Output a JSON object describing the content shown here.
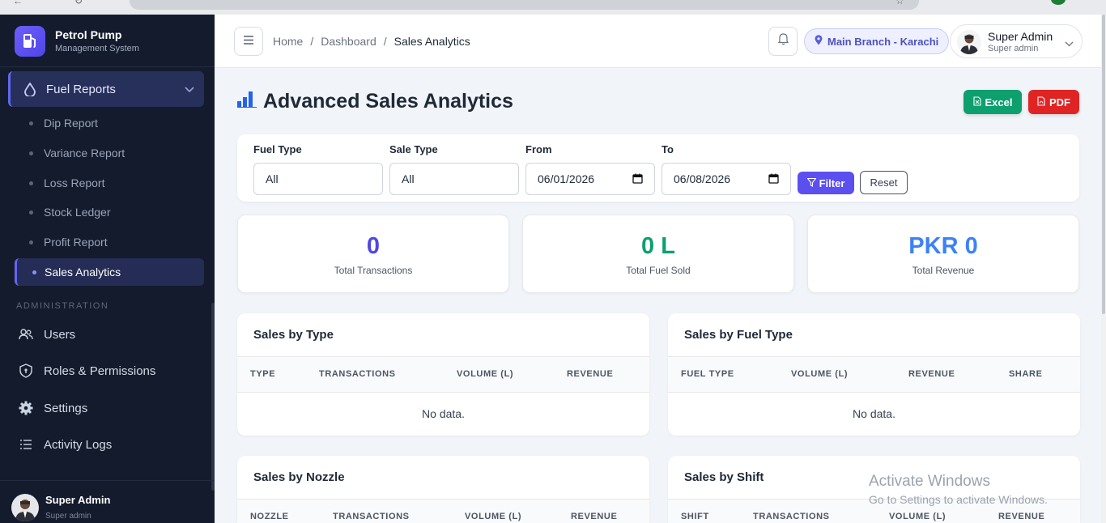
{
  "brand": {
    "title": "Petrol Pump",
    "subtitle": "Management System"
  },
  "sidebar": {
    "parent": {
      "label": "Fuel Reports",
      "icon": "droplet-icon"
    },
    "reports": [
      "Dip Report",
      "Variance Report",
      "Loss Report",
      "Stock Ledger",
      "Profit Report"
    ],
    "active": "Sales Analytics",
    "section_label": "ADMINISTRATION",
    "admin_items": [
      {
        "label": "Users",
        "icon": "users-icon"
      },
      {
        "label": "Roles & Permissions",
        "icon": "shield-icon"
      },
      {
        "label": "Settings",
        "icon": "gear-icon"
      },
      {
        "label": "Activity Logs",
        "icon": "list-icon"
      }
    ],
    "user": {
      "name": "Super Admin",
      "role": "Super admin"
    }
  },
  "topbar": {
    "breadcrumbs": [
      "Home",
      "Dashboard",
      "Sales Analytics"
    ],
    "separator": "/",
    "branch": "Main Branch - Karachi",
    "user": {
      "name": "Super Admin",
      "role": "Super admin"
    }
  },
  "page": {
    "title": "Advanced Sales Analytics",
    "excel_label": "Excel",
    "pdf_label": "PDF"
  },
  "filters": {
    "fuel_type": {
      "label": "Fuel Type",
      "value": "All"
    },
    "sale_type": {
      "label": "Sale Type",
      "value": "All"
    },
    "from": {
      "label": "From",
      "value": "06/01/2026"
    },
    "to": {
      "label": "To",
      "value": "06/08/2026"
    },
    "filter_label": "Filter",
    "reset_label": "Reset"
  },
  "stats": [
    {
      "value": "0",
      "label": "Total Transactions",
      "color": "#4f46e5"
    },
    {
      "value": "0 L",
      "label": "Total Fuel Sold",
      "color": "#0e9f6e"
    },
    {
      "value": "PKR 0",
      "label": "Total Revenue",
      "color": "#3b82f6"
    }
  ],
  "tables": {
    "by_type": {
      "title": "Sales by Type",
      "columns": [
        "TYPE",
        "TRANSACTIONS",
        "VOLUME (L)",
        "REVENUE"
      ],
      "empty": "No data."
    },
    "by_fuel": {
      "title": "Sales by Fuel Type",
      "columns": [
        "FUEL TYPE",
        "VOLUME (L)",
        "REVENUE",
        "SHARE"
      ],
      "empty": "No data."
    },
    "by_nozzle": {
      "title": "Sales by Nozzle",
      "columns": [
        "NOZZLE",
        "TRANSACTIONS",
        "VOLUME (L)",
        "REVENUE"
      ]
    },
    "by_shift": {
      "title": "Sales by Shift",
      "columns": [
        "SHIFT",
        "TRANSACTIONS",
        "VOLUME (L)",
        "REVENUE"
      ]
    }
  },
  "watermark": {
    "line1": "Activate Windows",
    "line2": "Go to Settings to activate Windows."
  }
}
